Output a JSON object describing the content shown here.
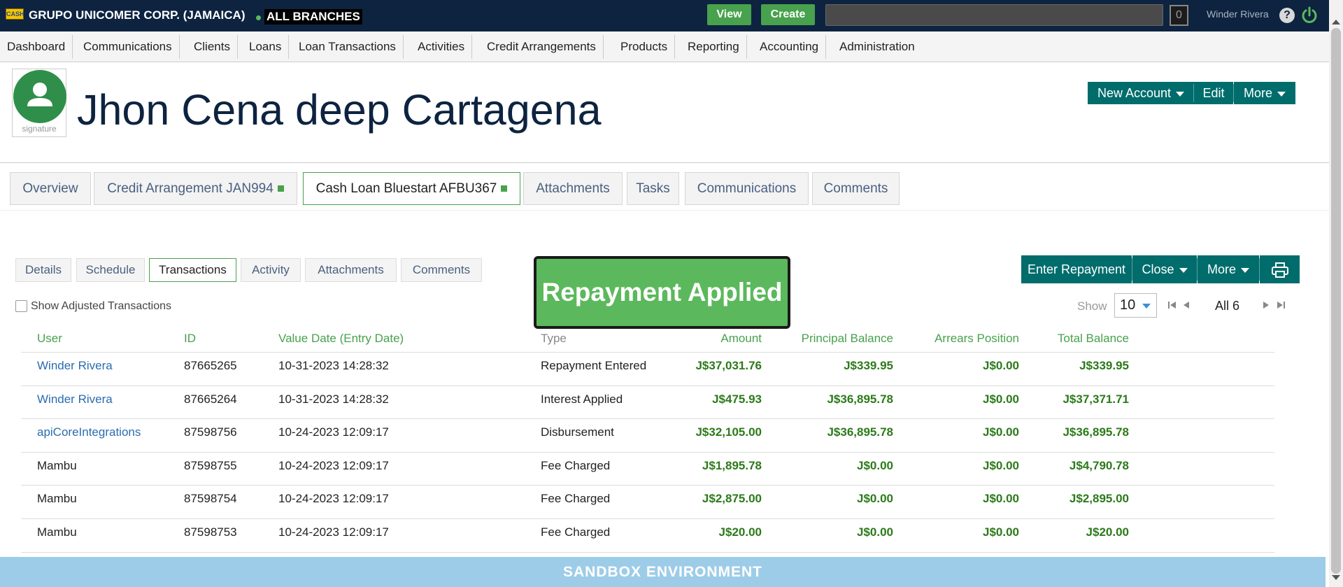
{
  "topbar": {
    "logo_text": "CASH",
    "organization": "GRUPO UNICOMER CORP. (JAMAICA)",
    "branch": "ALL BRANCHES",
    "view_label": "View",
    "create_label": "Create",
    "search_placeholder": "",
    "notifications_count": "0",
    "user_name": "Winder Rivera",
    "help_label": "?"
  },
  "nav": [
    "Dashboard",
    "Communications",
    "Clients",
    "Loans",
    "Loan Transactions",
    "Activities",
    "Credit Arrangements",
    "Products",
    "Reporting",
    "Accounting",
    "Administration"
  ],
  "client": {
    "avatar_caption": "signature",
    "name": "Jhon Cena deep Cartagena"
  },
  "client_actions": {
    "new_account": "New Account",
    "edit": "Edit",
    "more": "More"
  },
  "main_tabs": [
    {
      "label": "Overview"
    },
    {
      "label": "Credit Arrangement JAN994"
    },
    {
      "label": "Cash Loan Bluestart AFBU367"
    },
    {
      "label": "Attachments"
    },
    {
      "label": "Tasks"
    },
    {
      "label": "Communications"
    },
    {
      "label": "Comments"
    }
  ],
  "sub_tabs": [
    "Details",
    "Schedule",
    "Transactions",
    "Activity",
    "Attachments",
    "Comments"
  ],
  "toast": "Repayment Applied",
  "loan_actions": {
    "enter_repayment": "Enter Repayment",
    "close": "Close",
    "more": "More"
  },
  "show_adjusted_label": "Show Adjusted Transactions",
  "pager": {
    "show_label": "Show",
    "page_size": "10",
    "all_label": "All 6"
  },
  "table": {
    "columns": [
      "User",
      "ID",
      "Value Date (Entry Date)",
      "Type",
      "Amount",
      "Principal Balance",
      "Arrears Position",
      "Total Balance"
    ],
    "rows": [
      [
        "Winder Rivera",
        "87665265",
        "10-31-2023 14:28:32",
        "Repayment Entered",
        "J$37,031.76",
        "J$339.95",
        "J$0.00",
        "J$339.95"
      ],
      [
        "Winder Rivera",
        "87665264",
        "10-31-2023 14:28:32",
        "Interest Applied",
        "J$475.93",
        "J$36,895.78",
        "J$0.00",
        "J$37,371.71"
      ],
      [
        "apiCoreIntegrations",
        "87598756",
        "10-24-2023 12:09:17",
        "Disbursement",
        "J$32,105.00",
        "J$36,895.78",
        "J$0.00",
        "J$36,895.78"
      ],
      [
        "Mambu",
        "87598755",
        "10-24-2023 12:09:17",
        "Fee Charged",
        "J$1,895.78",
        "J$0.00",
        "J$0.00",
        "J$4,790.78"
      ],
      [
        "Mambu",
        "87598754",
        "10-24-2023 12:09:17",
        "Fee Charged",
        "J$2,875.00",
        "J$0.00",
        "J$0.00",
        "J$2,895.00"
      ],
      [
        "Mambu",
        "87598753",
        "10-24-2023 12:09:17",
        "Fee Charged",
        "J$20.00",
        "J$0.00",
        "J$0.00",
        "J$20.00"
      ]
    ]
  },
  "footer_banner": "SANDBOX ENVIRONMENT",
  "colors": {
    "topbar": "#0d2340",
    "accent_green": "#48a14d",
    "teal": "#006c6c",
    "sandbox": "#9dcce8"
  }
}
